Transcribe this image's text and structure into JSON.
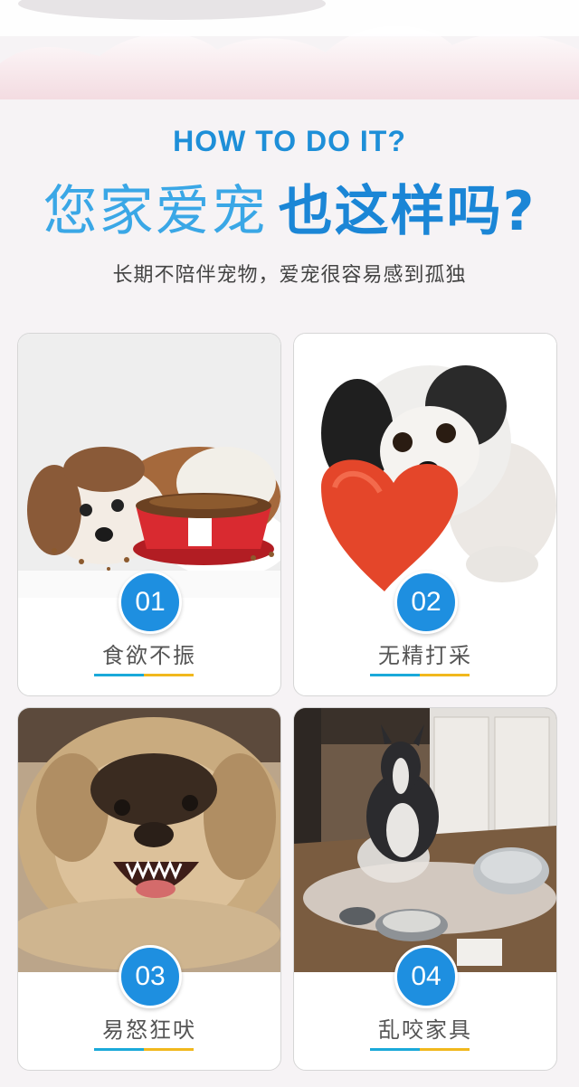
{
  "header": {
    "eyebrow": "HOW TO DO IT?",
    "headline_light": "您家爱宠",
    "headline_bold": "也这样吗?",
    "subline": "长期不陪伴宠物，爱宠很容易感到孤独"
  },
  "cards": [
    {
      "number": "01",
      "label": "食欲不振"
    },
    {
      "number": "02",
      "label": "无精打采"
    },
    {
      "number": "03",
      "label": "易怒狂吠"
    },
    {
      "number": "04",
      "label": "乱咬家具"
    }
  ],
  "colors": {
    "accent_blue": "#1e8fe0",
    "underline_teal": "#1aa9d9",
    "underline_yellow": "#f1b81d"
  }
}
